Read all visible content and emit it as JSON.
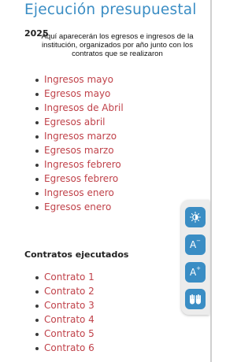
{
  "page": {
    "title": "Ejecución presupuestal",
    "year": "2025",
    "intro": "Aquí aparecerán los egresos e ingresos de la institución, organizados por año junto con los contratos que se realizaron"
  },
  "budget_links": [
    "Ingresos mayo",
    "Egresos mayo",
    "Ingresos de Abril",
    "Egresos abril",
    "Ingresos marzo",
    "Egresos  marzo",
    "Ingresos  febrero",
    "Egresos febrero",
    "Ingresos enero",
    "Egresos enero"
  ],
  "contracts": {
    "heading": "Contratos ejecutados",
    "items": [
      "Contrato 1",
      "Contrato 2",
      "Contrato 3",
      "Contrato 4",
      "Contrato 5",
      "Contrato 6"
    ]
  },
  "accessibility_toolbar": {
    "buttons": [
      {
        "icon": "contrast-icon"
      },
      {
        "icon": "decrease-font-icon",
        "label": "A",
        "sup": "−"
      },
      {
        "icon": "increase-font-icon",
        "label": "A",
        "sup": "+"
      },
      {
        "icon": "sign-language-icon"
      }
    ]
  },
  "colors": {
    "title": "#3a8dc4",
    "link": "#c0424a",
    "toolbar_button": "#3a8dc4"
  }
}
